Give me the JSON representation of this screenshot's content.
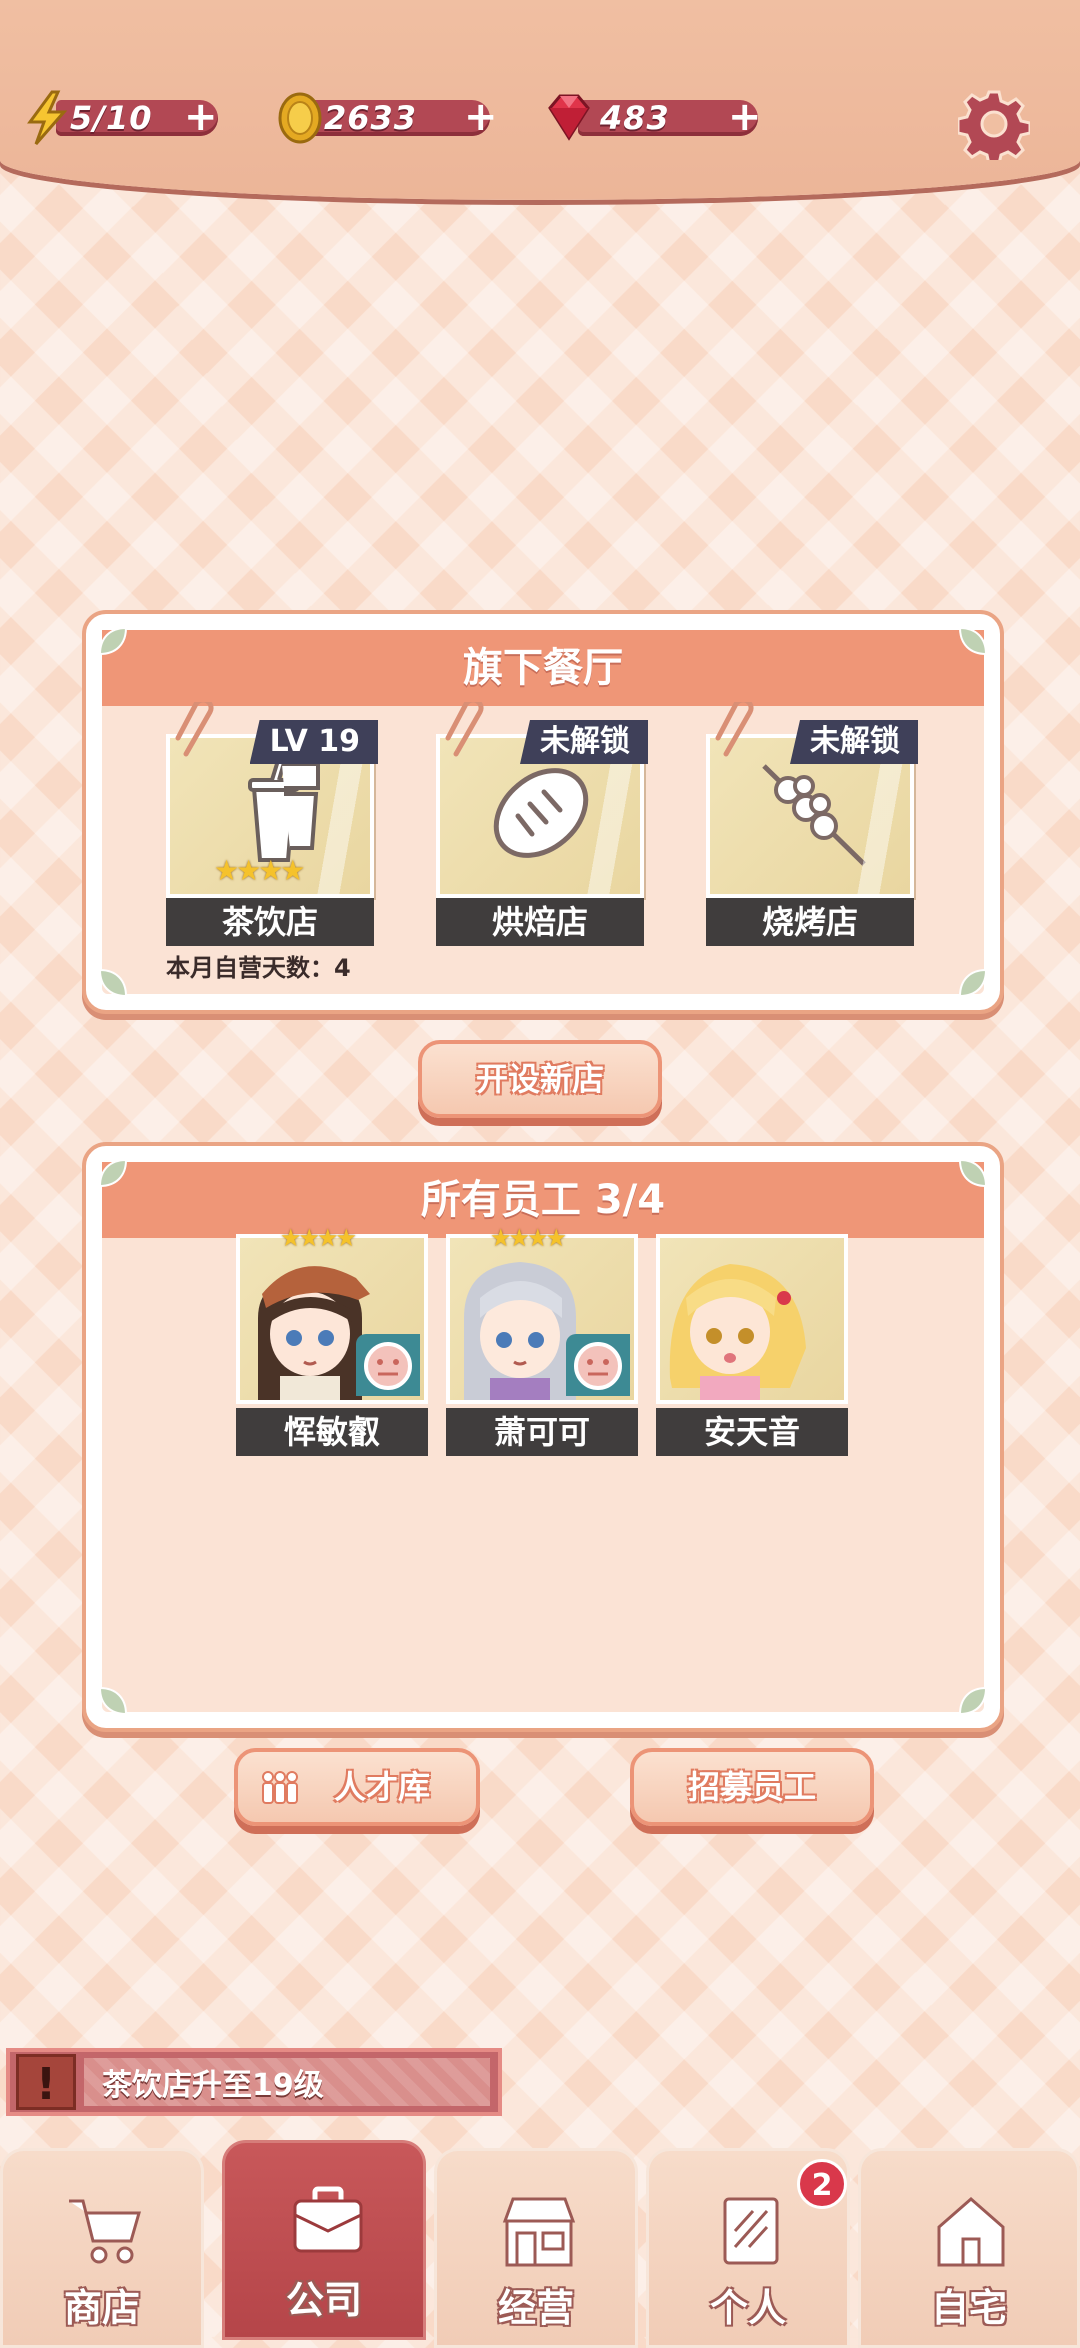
{
  "resources": {
    "energy": "5/10",
    "coins": "2633",
    "gems": "483",
    "plus": "+"
  },
  "restaurants": {
    "title": "旗下餐厅",
    "shops": [
      {
        "name": "茶饮店",
        "tag": "LV 19",
        "stars": "★★★★",
        "icon": "tea-cup-icon"
      },
      {
        "name": "烘焙店",
        "tag": "未解锁",
        "icon": "bread-icon"
      },
      {
        "name": "烧烤店",
        "tag": "未解锁",
        "icon": "skewer-icon"
      }
    ],
    "days_label": "本月自营天数：4"
  },
  "open_shop_label": "开设新店",
  "staff": {
    "title": "所有员工 3/4",
    "members": [
      {
        "name": "恽敏叡",
        "stars": "★★★★"
      },
      {
        "name": "萧可可",
        "stars": "★★★★"
      },
      {
        "name": "安天音"
      }
    ]
  },
  "buttons": {
    "talent": "人才库",
    "recruit": "招募员工"
  },
  "notice": {
    "icon": "!",
    "text": "茶饮店升至19级"
  },
  "nav": {
    "items": [
      {
        "label": "商店",
        "icon": "cart-icon"
      },
      {
        "label": "公司",
        "icon": "briefcase-icon"
      },
      {
        "label": "经营",
        "icon": "storefront-icon"
      },
      {
        "label": "个人",
        "icon": "id-card-icon",
        "badge": "2"
      },
      {
        "label": "自宅",
        "icon": "house-icon"
      }
    ]
  },
  "colors": {
    "accent": "#ef9677",
    "pill": "#b24854",
    "active_tab": "#b54549"
  }
}
